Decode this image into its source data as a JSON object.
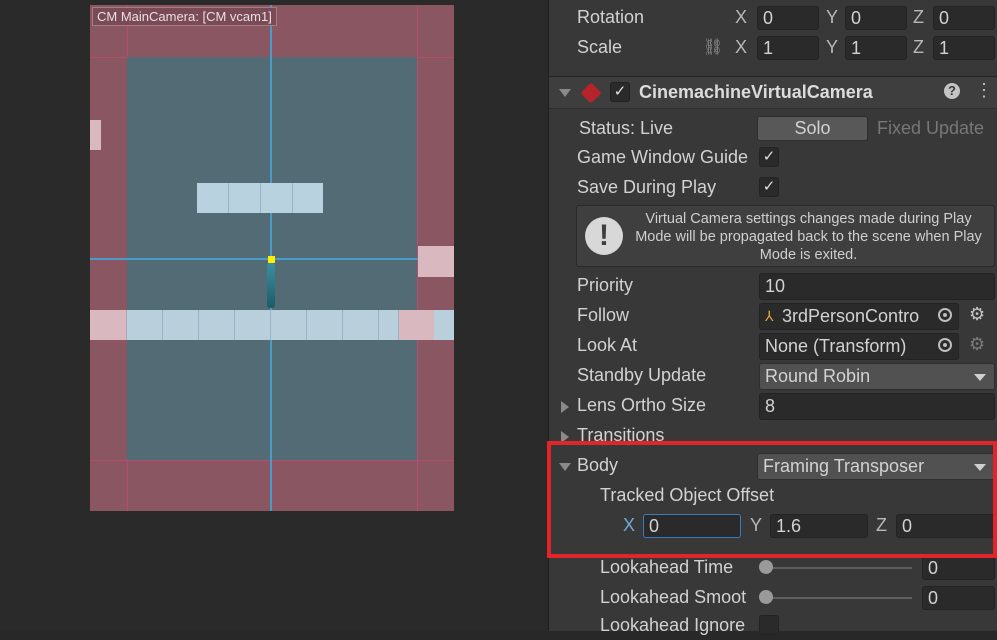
{
  "scene": {
    "camera_label": "CM MainCamera: [CM vcam1]"
  },
  "transform": {
    "rotation_label": "Rotation",
    "rotation": {
      "x": "0",
      "y": "0",
      "z": "0"
    },
    "scale_label": "Scale",
    "scale": {
      "x": "1",
      "y": "1",
      "z": "1"
    },
    "axis_x": "X",
    "axis_y": "Y",
    "axis_z": "Z"
  },
  "component": {
    "title": "CinemachineVirtualCamera",
    "help_icon": "?",
    "menu_icon": "⋮"
  },
  "status": {
    "label": "Status: Live",
    "solo_button": "Solo",
    "fixed_update": "Fixed Update"
  },
  "game_window_guides": {
    "label": "Game Window Guide",
    "checked": true
  },
  "save_during_play": {
    "label": "Save During Play",
    "checked": true
  },
  "warning": {
    "text": "Virtual Camera settings changes made during Play Mode will be propagated back to the scene when Play Mode is exited."
  },
  "priority": {
    "label": "Priority",
    "value": "10"
  },
  "follow": {
    "label": "Follow",
    "value": "3rdPersonContro"
  },
  "look_at": {
    "label": "Look At",
    "value": "None (Transform)"
  },
  "standby_update": {
    "label": "Standby Update",
    "value": "Round Robin"
  },
  "lens": {
    "label": "Lens Ortho Size",
    "value": "8"
  },
  "transitions": {
    "label": "Transitions"
  },
  "body": {
    "label": "Body",
    "value": "Framing Transposer",
    "tracked_object_offset": {
      "label": "Tracked Object Offset",
      "x": "0",
      "y": "1.6",
      "z": "0"
    }
  },
  "lookahead_time": {
    "label": "Lookahead Time",
    "value": "0",
    "fraction": 0
  },
  "lookahead_smoothing": {
    "label": "Lookahead Smoot",
    "value": "0",
    "fraction": 0
  },
  "lookahead_ignore": {
    "label": "Lookahead Ignore"
  },
  "colors": {
    "highlight_border": "#e0262b",
    "active_axis": "#6fa8dc",
    "live_dot": "#ffee00"
  }
}
